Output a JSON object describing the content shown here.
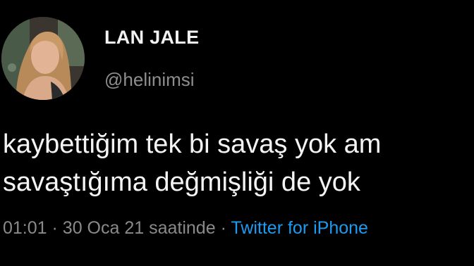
{
  "user": {
    "display_name": "LAN JALE",
    "handle": "@helinimsi",
    "avatar": "profile-photo"
  },
  "tweet": {
    "lines": [
      "kaybettiğim tek bi savaş yok am",
      "savaştığıma değmişliği de yok"
    ],
    "time": "01:01",
    "separator": "·",
    "date": "30 Oca 21 saatinde",
    "source": "Twitter for iPhone"
  },
  "colors": {
    "background": "#000000",
    "text": "#f4f4f4",
    "muted": "#8a8a8a",
    "link": "#1d9bf0"
  }
}
